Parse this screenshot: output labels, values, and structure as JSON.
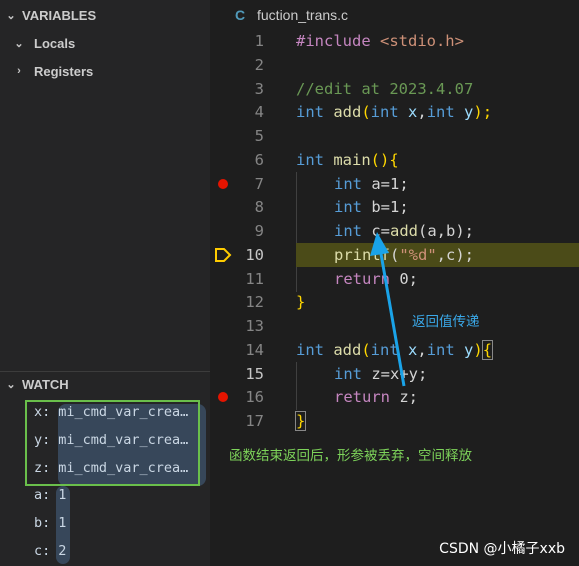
{
  "sidebar": {
    "variables_header": "VARIABLES",
    "locals_label": "Locals",
    "registers_label": "Registers",
    "watch_header": "WATCH",
    "watch_items": [
      {
        "name": "x:",
        "value": "mi_cmd_var_crea…"
      },
      {
        "name": "y:",
        "value": "mi_cmd_var_crea…"
      },
      {
        "name": "z:",
        "value": "mi_cmd_var_crea…"
      },
      {
        "name": "a:",
        "value": "1"
      },
      {
        "name": "b:",
        "value": "1"
      },
      {
        "name": "c:",
        "value": "2"
      }
    ]
  },
  "editor": {
    "tab_icon": "C",
    "tab_title": "fuction_trans.c",
    "line_numbers": [
      "1",
      "2",
      "3",
      "4",
      "5",
      "6",
      "7",
      "8",
      "9",
      "10",
      "11",
      "12",
      "13",
      "14",
      "15",
      "16",
      "17"
    ],
    "lines": {
      "l1a": "#include",
      "l1b": " <stdio.h>",
      "l3": "//edit at 2023.4.07",
      "kw_int": "int",
      "l4_fn": " add",
      "l4_rest": "(",
      "l4_x": " x",
      "l4_comma": ",",
      "l4_y": " y",
      "l4_end": ");",
      "l6_main": " main",
      "l6_paren": "()",
      "l6_brace": "{",
      "l7_rest": " a=1;",
      "l8_rest": " b=1;",
      "l9_c": " c=",
      "l9_add": "add",
      "l9_args": "(a,b);",
      "l10_printf": "printf",
      "l10_open": "(",
      "l10_str": "\"%d\"",
      "l10_rest": ",c);",
      "l11_return": "return",
      "l11_rest": " 0;",
      "l12_brace": "}",
      "l14_add": " add",
      "l14_open": "(",
      "l14_x": " x",
      "l14_comma": ",",
      "l14_y": " y",
      "l14_close": ")",
      "l14_brace": "{",
      "l15_rest": " z=x+y;",
      "l16_return": "return",
      "l16_rest": " z;",
      "l17_brace": "}"
    }
  },
  "annotations": {
    "return_value_note": "返回值传递",
    "cleanup_note": "函数结束返回后，形参被丢弃，空间释放",
    "arrow_color": "#1aa3e8",
    "note_blue": "#3aa8e8",
    "note_green": "#7dd35a"
  },
  "watermark": "CSDN @小橘子xxb",
  "breakpoint_lines": [
    7,
    16
  ],
  "current_line": 10
}
